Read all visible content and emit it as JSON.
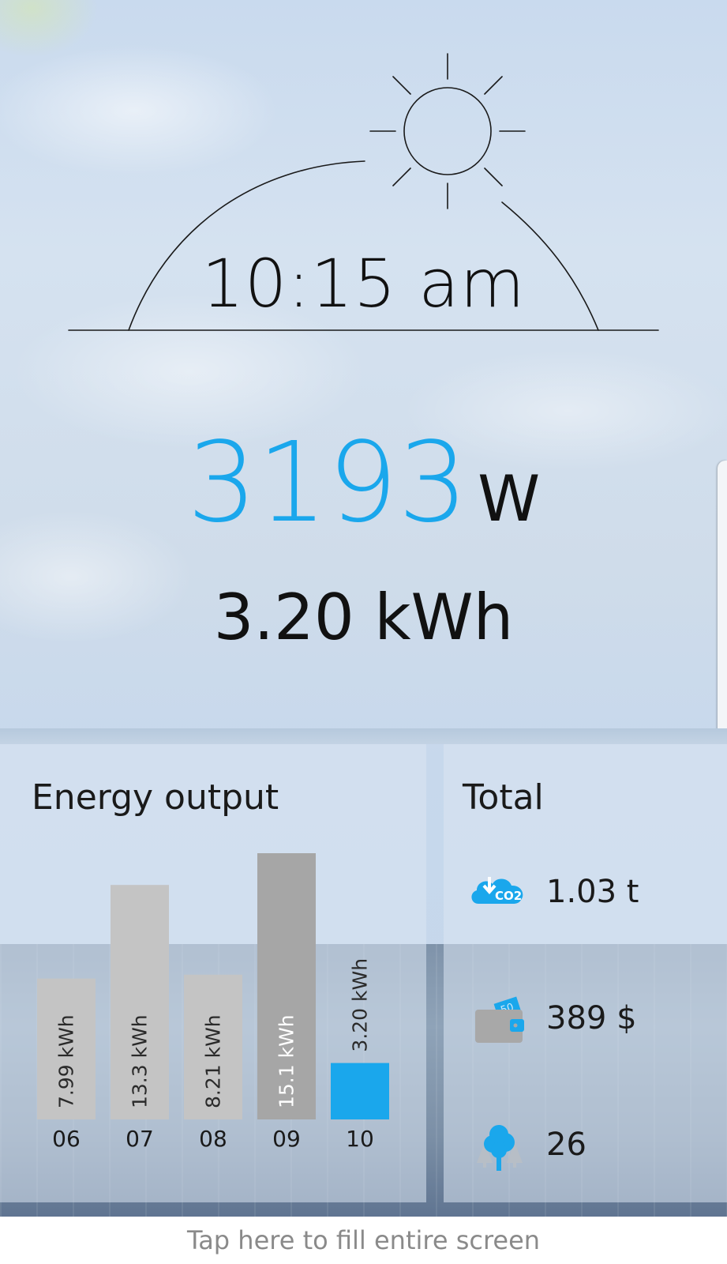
{
  "clock": {
    "time": "10:15 am"
  },
  "current": {
    "power_value": "3193",
    "power_unit": "W",
    "energy_today": "3.20 kWh"
  },
  "energy_panel": {
    "title": "Energy output"
  },
  "chart_data": {
    "type": "bar",
    "categories": [
      "06",
      "07",
      "08",
      "09",
      "10"
    ],
    "values": [
      7.99,
      13.3,
      8.21,
      15.1,
      3.2
    ],
    "data_labels": [
      "7.99 kWh",
      "13.3 kWh",
      "8.21 kWh",
      "15.1 kWh",
      "3.20 kWh"
    ],
    "ylim": [
      0,
      15.1
    ],
    "colors": [
      "#c4c4c4",
      "#c4c4c4",
      "#c4c4c4",
      "#a6a6a6",
      "#1aa7ec"
    ],
    "grid": false,
    "title": "",
    "xlabel": "",
    "ylabel": ""
  },
  "total_panel": {
    "title": "Total",
    "items": [
      {
        "icon": "co2-cloud-icon",
        "value": "1.03 t",
        "icon_label": "CO2"
      },
      {
        "icon": "wallet-icon",
        "value": "389 $",
        "icon_label": "50"
      },
      {
        "icon": "tree-icon",
        "value": "26"
      }
    ]
  },
  "footer": {
    "label": "Tap here to fill entire screen"
  },
  "colors": {
    "accent": "#1aa7ec",
    "text": "#111111",
    "footer_text": "#8a8a8a"
  }
}
